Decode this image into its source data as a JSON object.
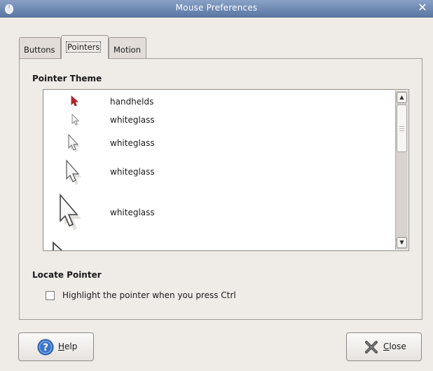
{
  "window": {
    "title": "Mouse Preferences"
  },
  "tabs": [
    {
      "label": "Buttons",
      "active": false
    },
    {
      "label": "Pointers",
      "active": true
    },
    {
      "label": "Motion",
      "active": false
    }
  ],
  "pointer_theme": {
    "heading": "Pointer Theme",
    "items": [
      {
        "name": "handhelds",
        "icon": "red-arrow-cursor-icon"
      },
      {
        "name": "whiteglass",
        "icon": "white-arrow-cursor-icon-small"
      },
      {
        "name": "whiteglass",
        "icon": "white-arrow-cursor-icon-medium"
      },
      {
        "name": "whiteglass",
        "icon": "white-arrow-cursor-icon-large"
      },
      {
        "name": "whiteglass",
        "icon": "white-arrow-cursor-icon-xlarge"
      }
    ]
  },
  "locate_pointer": {
    "heading": "Locate Pointer",
    "checkbox_label": "Highlight the pointer when you press Ctrl",
    "checked": false
  },
  "buttons": {
    "help_accel": "H",
    "help_rest": "elp",
    "close_accel": "C",
    "close_rest": "lose"
  }
}
